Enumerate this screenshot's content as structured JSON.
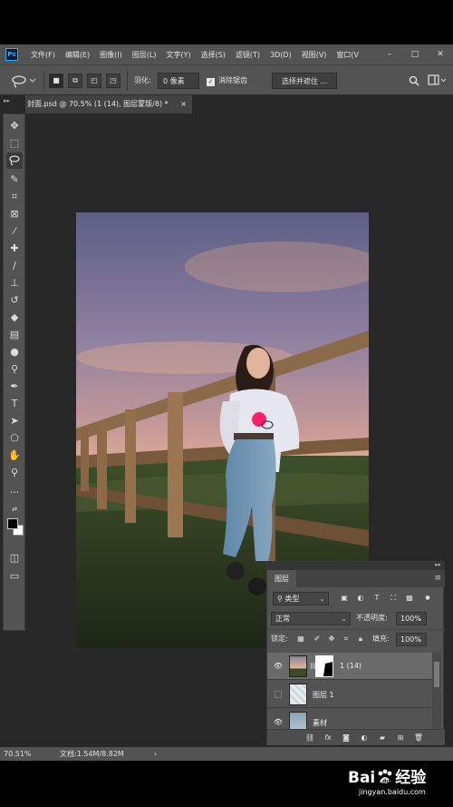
{
  "app": {
    "logo_text": "Ps",
    "menus": [
      "文件(F)",
      "编辑(E)",
      "图像(I)",
      "图层(L)",
      "文字(Y)",
      "选择(S)",
      "滤镜(T)",
      "3D(D)",
      "视图(V)",
      "窗口(V"
    ],
    "window_controls": {
      "minimize": "–",
      "maximize": "□",
      "close": "✕"
    }
  },
  "options": {
    "feather_label": "羽化:",
    "feather_value": "0 像素",
    "antialias_label": "消除锯齿",
    "select_mask_button": "选择并遮住 ..."
  },
  "document": {
    "tab_title": "封面.psd @ 70.5% (1 (14), 图层蒙版/8) *",
    "tab_close": "×"
  },
  "layers_panel": {
    "tab_label": "图层",
    "filter_kind": "类型",
    "blend_mode": "正常",
    "opacity_label": "不透明度:",
    "opacity_value": "100%",
    "lock_label": "锁定:",
    "fill_label": "填充:",
    "fill_value": "100%",
    "layers": [
      {
        "name": "1 (14)",
        "visible": true,
        "selected": true,
        "has_mask": true
      },
      {
        "name": "图层 1",
        "visible": false,
        "selected": false,
        "has_mask": false
      },
      {
        "name": "素材",
        "visible": true,
        "selected": false,
        "has_mask": false
      }
    ],
    "footer_fx": "fx"
  },
  "status": {
    "zoom": "70.51%",
    "doc_info": "文档:1.54M/8.82M",
    "arrow": "›"
  },
  "watermark": {
    "brand_a": "Bai",
    "brand_b": "经验",
    "url": "jingyan.baidu.com"
  },
  "icons": {
    "lasso": "lasso-icon",
    "search": "search-icon",
    "eye": "eye-icon"
  },
  "colors": {
    "menubar": "#535353",
    "workspace": "#282828",
    "highlight_circle": "#ff1f6e",
    "ps_blue": "#31a8ff"
  }
}
